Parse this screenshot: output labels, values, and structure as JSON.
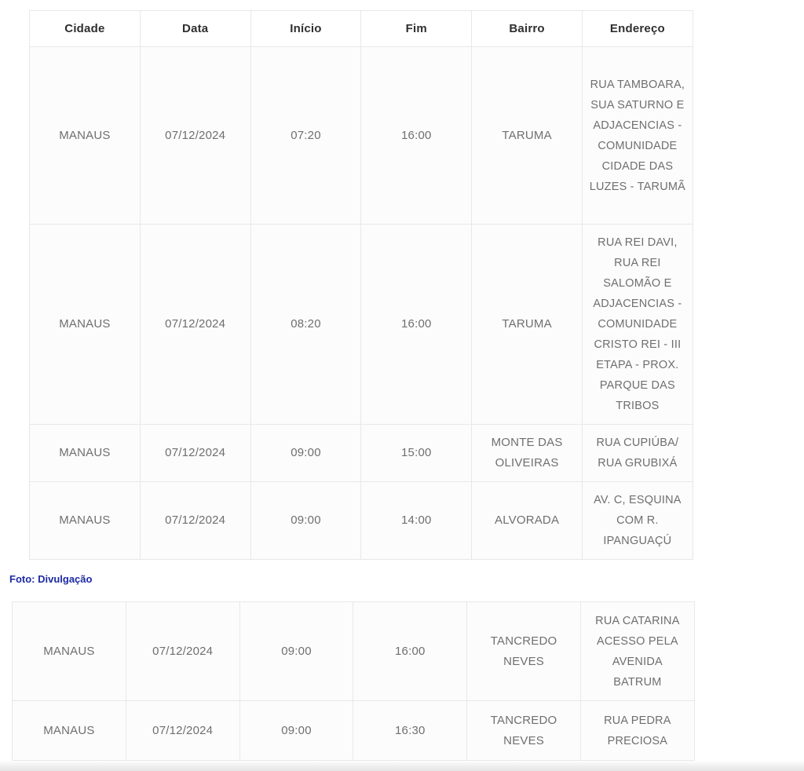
{
  "headers": [
    "Cidade",
    "Data",
    "Início",
    "Fim",
    "Bairro",
    "Endereço"
  ],
  "table_top": {
    "rows": [
      [
        "MANAUS",
        "07/12/2024",
        "07:20",
        "16:00",
        "TARUMA",
        "RUA TAMBOARA, SUA SATURNO E ADJACENCIAS - COMUNIDADE CIDADE DAS LUZES - TARUMÃ"
      ],
      [
        "MANAUS",
        "07/12/2024",
        "08:20",
        "16:00",
        "TARUMA",
        "RUA REI DAVI, RUA REI SALOMÃO E ADJACENCIAS - COMUNIDADE CRISTO REI - III ETAPA - PROX. PARQUE DAS TRIBOS"
      ],
      [
        "MANAUS",
        "07/12/2024",
        "09:00",
        "15:00",
        "MONTE DAS OLIVEIRAS",
        "RUA CUPIÚBA/ RUA GRUBIXÁ"
      ],
      [
        "MANAUS",
        "07/12/2024",
        "09:00",
        "14:00",
        "ALVORADA",
        "AV. C, ESQUINA COM R. IPANGUAÇÚ"
      ]
    ]
  },
  "caption": "Foto: Divulgação",
  "table_bottom": {
    "rows": [
      [
        "MANAUS",
        "07/12/2024",
        "09:00",
        "16:00",
        "TANCREDO NEVES",
        "RUA CATARINA ACESSO PELA AVENIDA BATRUM"
      ],
      [
        "MANAUS",
        "07/12/2024",
        "09:00",
        "16:30",
        "TANCREDO NEVES",
        "RUA PEDRA PRECIOSA"
      ]
    ]
  }
}
